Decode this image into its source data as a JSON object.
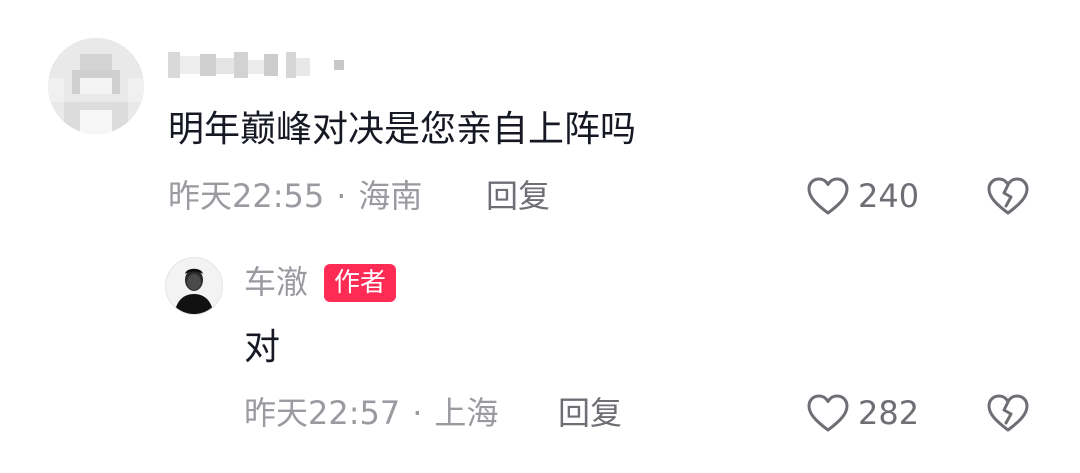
{
  "comment": {
    "username_pixelated": true,
    "text": "明年巅峰对决是您亲自上阵吗",
    "time": "昨天22:55",
    "separator": "·",
    "location": "海南",
    "reply_label": "回复",
    "likes": "240",
    "like_icon": "heart-outline-icon",
    "dislike_icon": "broken-heart-icon"
  },
  "reply": {
    "username": "车澈",
    "badge": "作者",
    "text": "对",
    "time": "昨天22:57",
    "separator": "·",
    "location": "上海",
    "reply_label": "回复",
    "likes": "282",
    "like_icon": "heart-outline-icon",
    "dislike_icon": "broken-heart-icon"
  },
  "colors": {
    "badge_bg": "#fe2c55",
    "text_primary": "#161823",
    "text_secondary": "#9a9ba0"
  }
}
